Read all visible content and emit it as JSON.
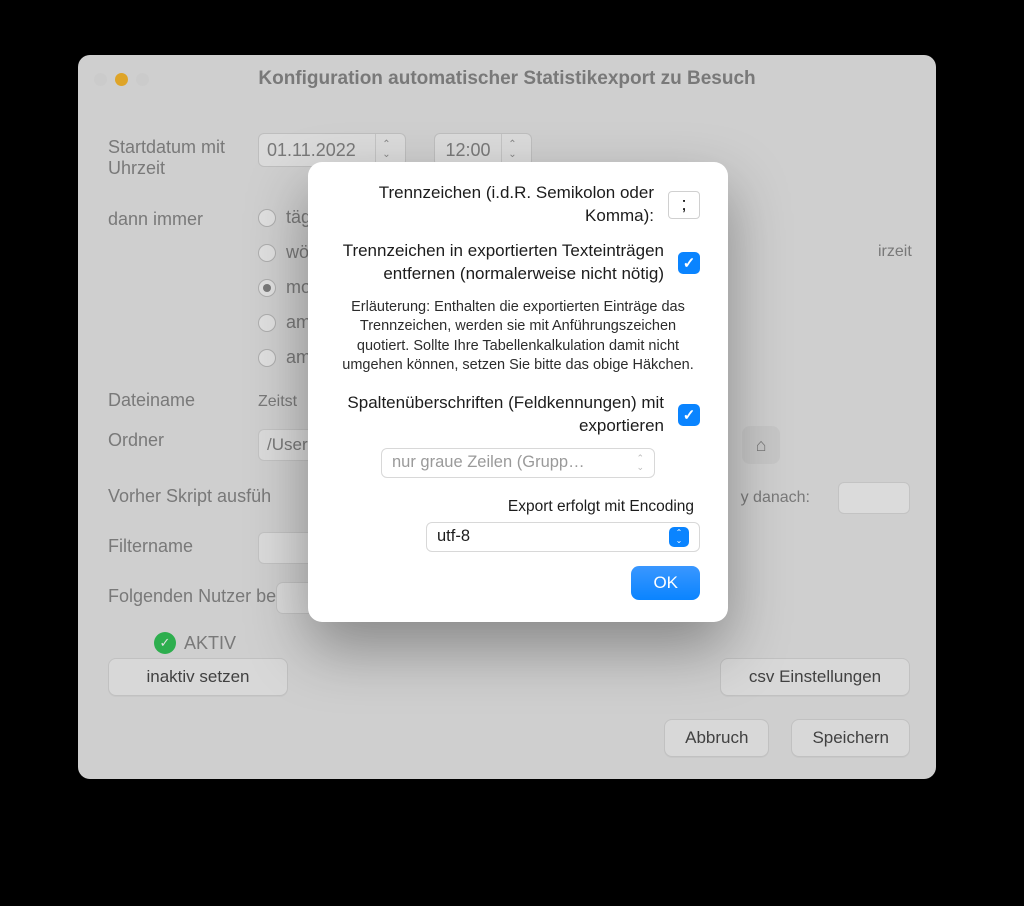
{
  "window": {
    "title": "Konfiguration automatischer Statistikexport zu Besuch",
    "startdate_label": "Startdatum mit Uhrzeit",
    "startdate": "01.11.2022",
    "starttime": "12:00",
    "recur_label": "dann immer",
    "recur_hint_visible": "irzeit",
    "radios": [
      "täg",
      "wö",
      "mo",
      "am",
      "am"
    ],
    "checked_radio_index": 2,
    "filename_label": "Dateiname",
    "filename_value": "Zeitst",
    "folder_label": "Ordner",
    "folder_value": "/User",
    "script_label": "Vorher Skript ausfüh",
    "delay_label": "y danach:",
    "filtername_label": "Filtername",
    "user_label": "Folgenden Nutzer be",
    "status_text": "AKTIV",
    "btn_deactivate": "inaktiv setzen",
    "btn_csv": "csv Einstellungen",
    "btn_cancel": "Abbruch",
    "btn_save": "Speichern"
  },
  "dialog": {
    "sep_label": "Trennzeichen (i.d.R. Semikolon oder Komma):",
    "sep_value": ";",
    "strip_label": "Trennzeichen in exportierten Texteinträgen entfernen (normalerweise nicht nötig)",
    "strip_checked": true,
    "note": "Erläuterung: Enthalten die exportierten Einträge das Trennzeichen, werden sie mit Anführungszeichen quotiert. Sollte Ihre Tabellenkalkulation damit nicht umgehen können, setzen Sie bitte das obige Häkchen.",
    "header_label": "Spaltenüberschriften (Feldkennungen) mit exportieren",
    "header_checked": true,
    "rows_select": "nur graue Zeilen (Grupp…",
    "encoding_label": "Export erfolgt mit Encoding",
    "encoding_value": "utf-8",
    "ok": "OK"
  }
}
